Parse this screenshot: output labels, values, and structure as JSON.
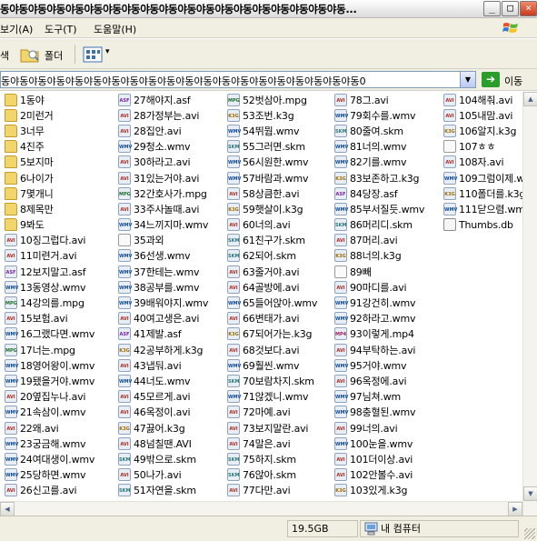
{
  "window": {
    "title": "동야동야동야동야동야동야동야동야동야동야동야동야동야동야동야동야동야동야동...",
    "minimize_glyph": "_",
    "maximize_glyph": "□",
    "close_glyph": "×"
  },
  "menu": {
    "items": [
      "보기(A)",
      "도구(T)",
      "도움말(H)"
    ]
  },
  "toolbar": {
    "search_label": "색",
    "folders_label": "폴더",
    "views_dropdown_glyph": "▾"
  },
  "address": {
    "value": "동야동야동야동야동야동야동야동야동야동야동야동야동야동야동야동야동야동야동야동0",
    "drop_glyph": "▼",
    "go_glyph": "➔",
    "go_label": "이동"
  },
  "columns": [
    [
      {
        "name": "1동야",
        "type": "folder"
      },
      {
        "name": "2미런거",
        "type": "folder"
      },
      {
        "name": "3너무",
        "type": "folder"
      },
      {
        "name": "4진주",
        "type": "folder"
      },
      {
        "name": "5보지마",
        "type": "folder"
      },
      {
        "name": "6나이가",
        "type": "folder"
      },
      {
        "name": "7몇개니",
        "type": "folder"
      },
      {
        "name": "8제목만",
        "type": "folder"
      },
      {
        "name": "9봐도",
        "type": "folder"
      },
      {
        "name": "10징그럽다.avi",
        "type": "avi"
      },
      {
        "name": "11미련거.avi",
        "type": "avi"
      },
      {
        "name": "12보지말고.asf",
        "type": "asf"
      },
      {
        "name": "13동영상.wmv",
        "type": "wmv"
      },
      {
        "name": "14강의를.mpg",
        "type": "mpg"
      },
      {
        "name": "15보험.avi",
        "type": "avi"
      },
      {
        "name": "16그랬다면.wmv",
        "type": "wmv"
      },
      {
        "name": "17너는.mpg",
        "type": "mpg"
      },
      {
        "name": "18영어왕이.wmv",
        "type": "wmv"
      },
      {
        "name": "19됐을거야.wmv",
        "type": "wmv"
      },
      {
        "name": "20옆집누나.avi",
        "type": "avi"
      },
      {
        "name": "21속삼이.wmv",
        "type": "wmv"
      },
      {
        "name": "22왜.avi",
        "type": "avi"
      },
      {
        "name": "23궁금해.wmv",
        "type": "wmv"
      },
      {
        "name": "24여대생이.wmv",
        "type": "wmv"
      },
      {
        "name": "25당하면.wmv",
        "type": "wmv"
      },
      {
        "name": "26신고를.avi",
        "type": "avi"
      }
    ],
    [
      {
        "name": "27해야지.asf",
        "type": "asf"
      },
      {
        "name": "28가정부는.avi",
        "type": "avi"
      },
      {
        "name": "28집안.avi",
        "type": "avi"
      },
      {
        "name": "29청소.wmv",
        "type": "wmv"
      },
      {
        "name": "30하라고.avi",
        "type": "avi"
      },
      {
        "name": "31있는거야.avi",
        "type": "avi"
      },
      {
        "name": "32간호사가.mpg",
        "type": "mpg"
      },
      {
        "name": "33주사놀때.avi",
        "type": "avi"
      },
      {
        "name": "34느끼지마.wmv",
        "type": "wmv"
      },
      {
        "name": "35과외",
        "type": "blank"
      },
      {
        "name": "36선생.wmv",
        "type": "wmv"
      },
      {
        "name": "37한테는.wmv",
        "type": "wmv"
      },
      {
        "name": "38공부를.wmv",
        "type": "wmv"
      },
      {
        "name": "39배워야지.wmv",
        "type": "wmv"
      },
      {
        "name": "40여고생은.avi",
        "type": "avi"
      },
      {
        "name": "41제발.asf",
        "type": "asf"
      },
      {
        "name": "42공부하게.k3g",
        "type": "k3g"
      },
      {
        "name": "43냅둬.avi",
        "type": "avi"
      },
      {
        "name": "44너도.wmv",
        "type": "wmv"
      },
      {
        "name": "45모르게.avi",
        "type": "avi"
      },
      {
        "name": "46옥정이.avi",
        "type": "avi"
      },
      {
        "name": "47끓어.k3g",
        "type": "k3g"
      },
      {
        "name": "48넘칠땐.AVI",
        "type": "avi"
      },
      {
        "name": "49밖으로.skm",
        "type": "skm"
      },
      {
        "name": "50나가.avi",
        "type": "avi"
      },
      {
        "name": "51자연을.skm",
        "type": "skm"
      }
    ],
    [
      {
        "name": "52벗삼아.mpg",
        "type": "mpg"
      },
      {
        "name": "53조번.k3g",
        "type": "k3g"
      },
      {
        "name": "54뛰뭡.wmv",
        "type": "wmv"
      },
      {
        "name": "55그러면.skm",
        "type": "skm"
      },
      {
        "name": "56시원한.wmv",
        "type": "wmv"
      },
      {
        "name": "57바람과.wmv",
        "type": "wmv"
      },
      {
        "name": "58상큼한.avi",
        "type": "avi"
      },
      {
        "name": "59햇살이.k3g",
        "type": "k3g"
      },
      {
        "name": "60너의.avi",
        "type": "avi"
      },
      {
        "name": "61친구가.skm",
        "type": "skm"
      },
      {
        "name": "62되어.skm",
        "type": "skm"
      },
      {
        "name": "63줄거야.avi",
        "type": "avi"
      },
      {
        "name": "64골방에.avi",
        "type": "avi"
      },
      {
        "name": "65들어앉아.wmv",
        "type": "wmv"
      },
      {
        "name": "66변태가.avi",
        "type": "avi"
      },
      {
        "name": "67되어가는.k3g",
        "type": "k3g"
      },
      {
        "name": "68것보다.avi",
        "type": "avi"
      },
      {
        "name": "69훨씬.wmv",
        "type": "wmv"
      },
      {
        "name": "70보람차지.skm",
        "type": "skm"
      },
      {
        "name": "71않겠니.wmv",
        "type": "wmv"
      },
      {
        "name": "72마예.avi",
        "type": "avi"
      },
      {
        "name": "73보지말란.avi",
        "type": "avi"
      },
      {
        "name": "74말은.avi",
        "type": "avi"
      },
      {
        "name": "75하지.skm",
        "type": "skm"
      },
      {
        "name": "76않아.skm",
        "type": "skm"
      },
      {
        "name": "77다만.avi",
        "type": "avi"
      }
    ],
    [
      {
        "name": "78그.avi",
        "type": "avi"
      },
      {
        "name": "79회수를.wmv",
        "type": "wmv"
      },
      {
        "name": "80줄여.skm",
        "type": "skm"
      },
      {
        "name": "81너의.wmv",
        "type": "wmv"
      },
      {
        "name": "82기를.wmv",
        "type": "wmv"
      },
      {
        "name": "83보존하고.k3g",
        "type": "k3g"
      },
      {
        "name": "84당장.asf",
        "type": "asf"
      },
      {
        "name": "85부서질듯.wmv",
        "type": "wmv"
      },
      {
        "name": "86머리디.skm",
        "type": "skm"
      },
      {
        "name": "87머리.avi",
        "type": "avi"
      },
      {
        "name": "88너의.k3g",
        "type": "k3g"
      },
      {
        "name": "89빼",
        "type": "blank"
      },
      {
        "name": "90마디를.avi",
        "type": "avi"
      },
      {
        "name": "91강건히.wmv",
        "type": "wmv"
      },
      {
        "name": "92하라고.wmv",
        "type": "wmv"
      },
      {
        "name": "93이렇게.mp4",
        "type": "mp4"
      },
      {
        "name": "94부탁하는.avi",
        "type": "avi"
      },
      {
        "name": "95거야.wmv",
        "type": "wmv"
      },
      {
        "name": "96옥정에.avi",
        "type": "avi"
      },
      {
        "name": "97님쳐.wm",
        "type": "wmv"
      },
      {
        "name": "98충혈된.wmv",
        "type": "wmv"
      },
      {
        "name": "99너의.avi",
        "type": "avi"
      },
      {
        "name": "100눈을.wmv",
        "type": "wmv"
      },
      {
        "name": "101더이상.avi",
        "type": "avi"
      },
      {
        "name": "102안볼수.avi",
        "type": "avi"
      },
      {
        "name": "103있게.k3g",
        "type": "k3g"
      }
    ],
    [
      {
        "name": "104해줘.avi",
        "type": "avi"
      },
      {
        "name": "105내맘.avi",
        "type": "avi"
      },
      {
        "name": "106알지.k3g",
        "type": "k3g"
      },
      {
        "name": "107ㅎㅎ",
        "type": "blank"
      },
      {
        "name": "108자.avi",
        "type": "avi"
      },
      {
        "name": "109그럼이제.wmv",
        "type": "wmv"
      },
      {
        "name": "110폴더를.k3g",
        "type": "k3g"
      },
      {
        "name": "111닫으렴.wmv",
        "type": "wmv"
      },
      {
        "name": "Thumbs.db",
        "type": "db"
      }
    ]
  ],
  "icon_badges": {
    "avi": "AVI",
    "wmv": "WMV",
    "asf": "ASF",
    "mpg": "MPG",
    "k3g": "K3G",
    "skm": "SKM",
    "mp4": "MP4",
    "blank": "",
    "db": "",
    "folder": ""
  },
  "status": {
    "size": "19.5GB",
    "location": "내 컴퓨터"
  },
  "scroll": {
    "up": "▲",
    "down": "▼",
    "left": "◀",
    "right": "▶"
  }
}
